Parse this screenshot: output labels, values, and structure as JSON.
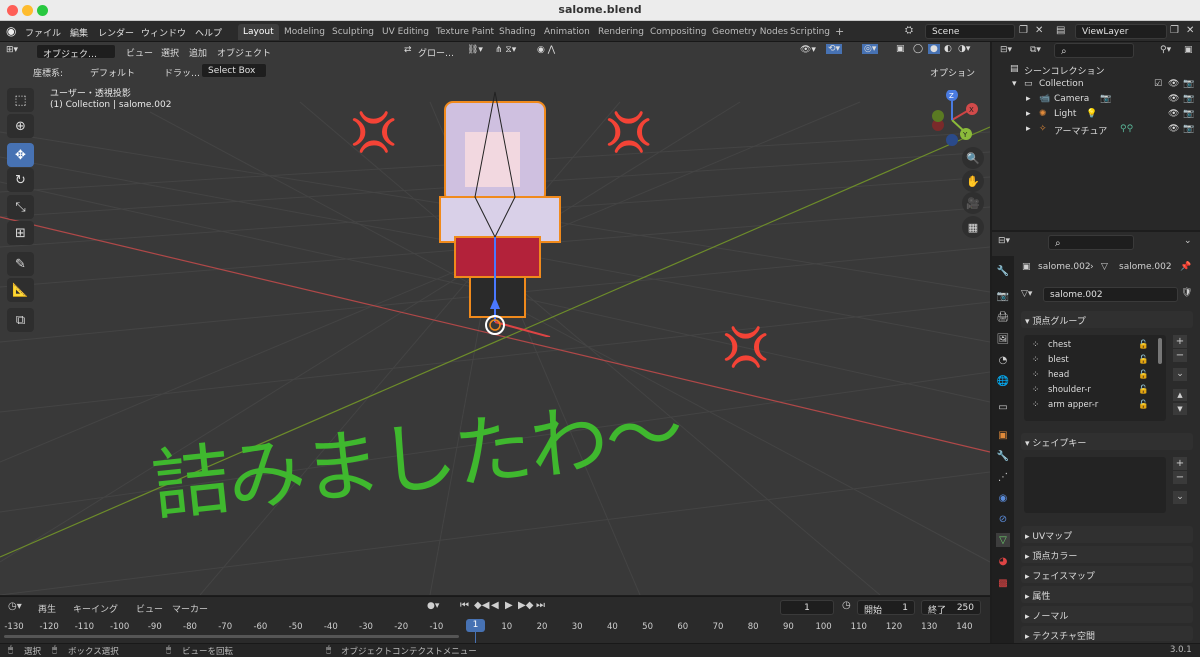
{
  "window": {
    "title": "salome.blend"
  },
  "menu": [
    "ファイル",
    "編集",
    "レンダー",
    "ウィンドウ",
    "ヘルプ"
  ],
  "workspaces": [
    {
      "label": "Layout",
      "active": true
    },
    {
      "label": "Modeling"
    },
    {
      "label": "Sculpting"
    },
    {
      "label": "UV Editing"
    },
    {
      "label": "Texture Paint"
    },
    {
      "label": "Shading"
    },
    {
      "label": "Animation"
    },
    {
      "label": "Rendering"
    },
    {
      "label": "Compositing"
    },
    {
      "label": "Geometry Nodes"
    },
    {
      "label": "Scripting"
    }
  ],
  "workspace_add": "+",
  "scene": {
    "label": "Scene"
  },
  "viewlayer": {
    "label": "ViewLayer"
  },
  "viewport_header": {
    "mode": "オブジェク…",
    "view": "ビュー",
    "select": "選択",
    "add": "追加",
    "object": "オブジェクト",
    "orientation": "グロー…"
  },
  "viewport_header2": {
    "coord_label": "座標系:",
    "coord_value": "デフォルト",
    "drag_label": "ドラッ…",
    "drag_value": "Select Box",
    "options": "オプション"
  },
  "viewport_info": {
    "line1": "ユーザー・透視投影",
    "line2": "(1) Collection | salome.002"
  },
  "handwriting": {
    "text": "詰みましたわ〜",
    "anger1": "💢",
    "anger2": "💢",
    "anger3": "💢"
  },
  "gizmo": {
    "x": "X",
    "y": "Y",
    "z": "Z"
  },
  "outliner": {
    "root": "シーンコレクション",
    "collection": "Collection",
    "items": [
      {
        "label": "Camera"
      },
      {
        "label": "Light"
      },
      {
        "label": "アーマチュア"
      }
    ]
  },
  "properties": {
    "breadcrumb_obj": "salome.002",
    "breadcrumb_mesh": "salome.002",
    "mesh_name": "salome.002",
    "vertex_groups_title": "頂点グループ",
    "vertex_groups": [
      "chest",
      "blest",
      "head",
      "shoulder-r",
      "arm apper-r"
    ],
    "shape_keys_title": "シェイプキー",
    "collapsed": [
      "UVマップ",
      "頂点カラー",
      "フェイスマップ",
      "属性",
      "ノーマル",
      "テクスチャ空間"
    ]
  },
  "timeline": {
    "play": "再生",
    "keying": "キーイング",
    "view": "ビュー",
    "marker": "マーカー",
    "current": "1",
    "start_label": "開始",
    "start": "1",
    "end_label": "終了",
    "end": "250",
    "ticks": [
      "-130",
      "-120",
      "-110",
      "-100",
      "-90",
      "-80",
      "-70",
      "-60",
      "-50",
      "-40",
      "-30",
      "-20",
      "-10",
      "1",
      "10",
      "20",
      "30",
      "40",
      "50",
      "60",
      "70",
      "80",
      "90",
      "100",
      "110",
      "120",
      "130",
      "140"
    ],
    "frame": "1"
  },
  "status": {
    "select": "選択",
    "box": "ボックス選択",
    "rotate": "ビューを回転",
    "context": "オブジェクトコンテクストメニュー",
    "version": "3.0.1"
  },
  "colors": {
    "accent": "#4772b3",
    "handwriting": "#3fb82e",
    "x_axis": "#c94444",
    "y_axis": "#7aa12a"
  }
}
